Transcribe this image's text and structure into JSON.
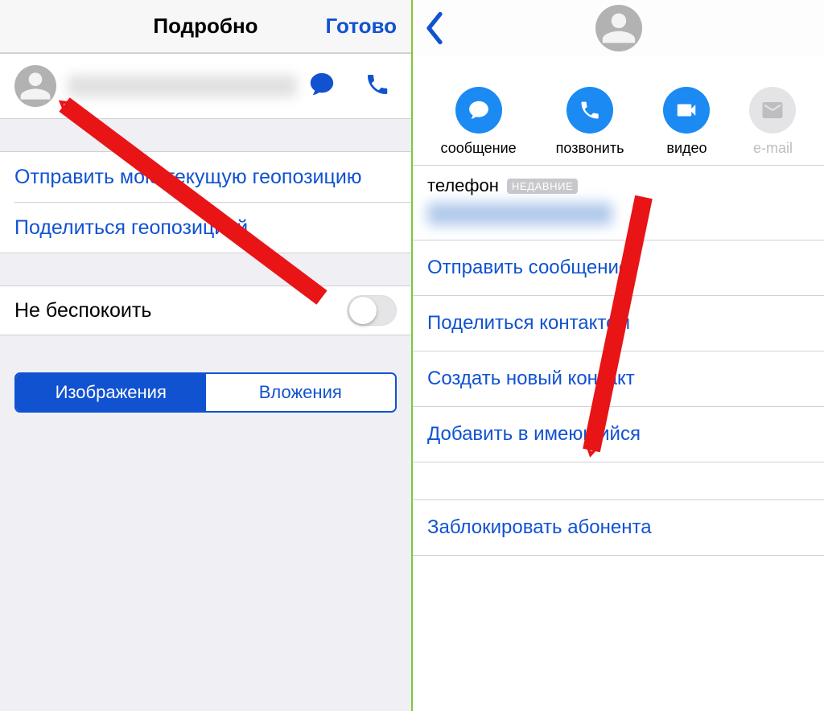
{
  "left": {
    "nav": {
      "title": "Подробно",
      "done": "Готово"
    },
    "location": {
      "send_current": "Отправить мою текущую геопозицию",
      "share": "Поделиться геопозицией"
    },
    "dnd": {
      "label": "Не беспокоить",
      "on": false
    },
    "segmented": {
      "images": "Изображения",
      "attachments": "Вложения"
    }
  },
  "right": {
    "actions": {
      "message": "сообщение",
      "call": "позвонить",
      "video": "видео",
      "email": "e-mail"
    },
    "phone": {
      "label": "телефон",
      "badge": "НЕДАВНИЕ"
    },
    "links": {
      "send_message": "Отправить сообщение",
      "share_contact": "Поделиться контактом",
      "new_contact": "Создать новый контакт",
      "add_existing": "Добавить в имеющийся",
      "block": "Заблокировать абонента"
    }
  }
}
